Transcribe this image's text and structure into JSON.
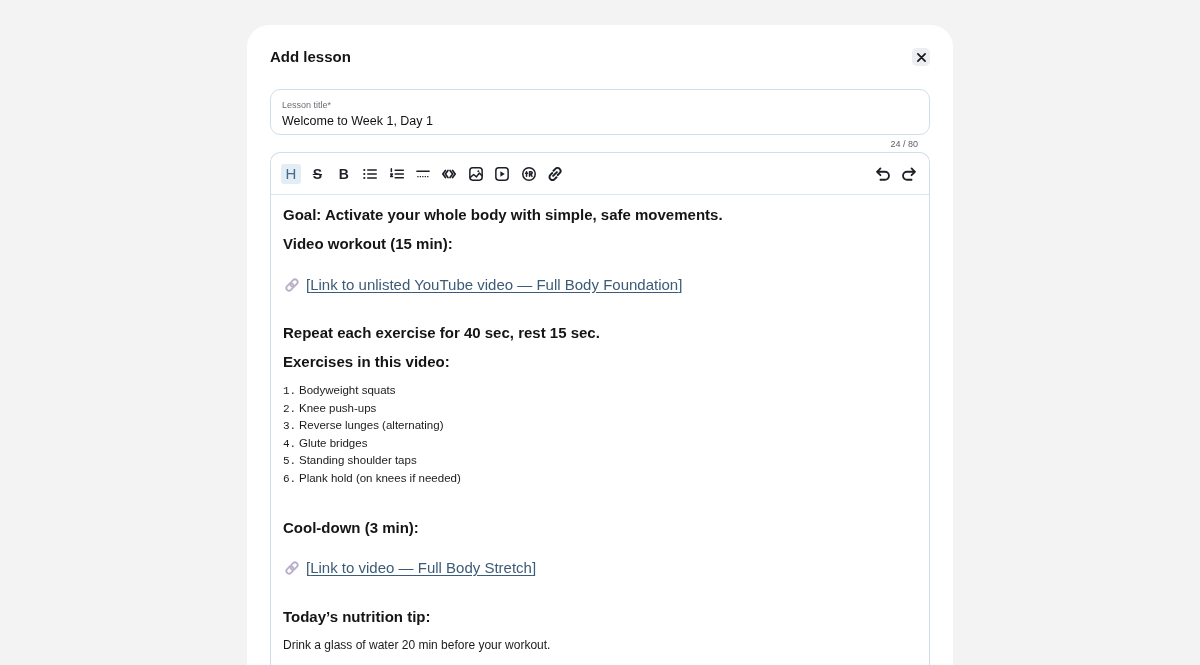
{
  "dialog": {
    "title": "Add lesson"
  },
  "title_field": {
    "label": "Lesson title*",
    "value": "Welcome to Week 1, Day 1",
    "counter": "24 / 80"
  },
  "editor": {
    "toolbar": {
      "tools": [
        {
          "kind": "heading",
          "label": "H",
          "selected": true
        },
        {
          "kind": "strike",
          "label": "S",
          "selected": false
        },
        {
          "kind": "bold",
          "label": "B",
          "selected": false
        },
        {
          "kind": "bullet-list",
          "selected": false
        },
        {
          "kind": "numbered-list",
          "selected": false
        },
        {
          "kind": "divider",
          "selected": false
        },
        {
          "kind": "code",
          "selected": false
        },
        {
          "kind": "image",
          "selected": false
        },
        {
          "kind": "video",
          "selected": false
        },
        {
          "kind": "symbol",
          "selected": false
        },
        {
          "kind": "link",
          "selected": false
        }
      ],
      "history": [
        {
          "kind": "undo"
        },
        {
          "kind": "redo"
        }
      ]
    },
    "blocks": [
      {
        "kind": "heading",
        "text": "Goal: Activate your whole body with simple, safe movements."
      },
      {
        "kind": "heading",
        "text": "Video workout (15 min):"
      },
      {
        "kind": "link",
        "open": "[",
        "text": "Link to unlisted YouTube video — Full Body Foundation",
        "close": "]"
      },
      {
        "kind": "heading",
        "text": "Repeat each exercise for 40 sec, rest 15 sec."
      },
      {
        "kind": "heading",
        "text": "Exercises in this video:"
      },
      {
        "kind": "list",
        "items": [
          {
            "number": "1.",
            "text": "Bodyweight squats"
          },
          {
            "number": "2.",
            "text": "Knee push-ups"
          },
          {
            "number": "3.",
            "text": "Reverse lunges (alternating)"
          },
          {
            "number": "4.",
            "text": "Glute bridges"
          },
          {
            "number": "5.",
            "text": "Standing shoulder taps"
          },
          {
            "number": "6.",
            "text": "Plank hold (on knees if needed)"
          }
        ]
      },
      {
        "kind": "heading",
        "text": "Cool-down (3 min):"
      },
      {
        "kind": "link",
        "open": "[",
        "text": "Link to video — Full Body Stretch",
        "close": "]"
      },
      {
        "kind": "heading",
        "text": "Today’s nutrition tip:"
      },
      {
        "kind": "paragraph",
        "text": "Drink a glass of water 20 min before your workout."
      }
    ]
  }
}
